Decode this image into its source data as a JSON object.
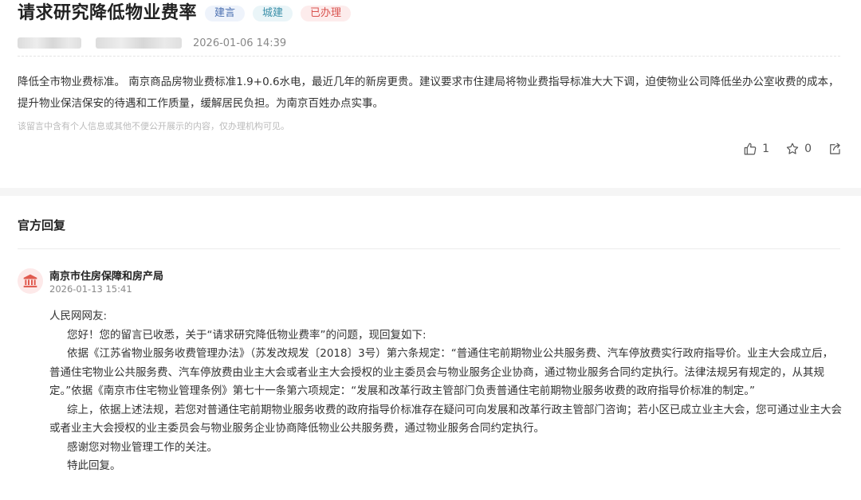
{
  "message": {
    "title": "请求研究降低物业费率",
    "tags": [
      {
        "label": "建言",
        "style": "blue"
      },
      {
        "label": "城建",
        "style": "cyan"
      },
      {
        "label": "已办理",
        "style": "red"
      }
    ],
    "datetime": "2026-01-06 14:39",
    "body": "降低全市物业费标准。 南京商品房物业费标准1.9+0.6水电，最近几年的新房更贵。建议要求市住建局将物业费指导标准大大下调，迫使物业公司降低坐办公室收费的成本，提升物业保洁保安的待遇和工作质量，缓解居民负担。为南京百姓办点实事。",
    "privacy_note": "该留言中含有个人信息或其他不便公开展示的内容，仅办理机构可见。",
    "likes": "1",
    "favorites": "0"
  },
  "reply_section": {
    "title": "官方回复",
    "department": "南京市住房保障和房产局",
    "datetime": "2026-01-13 15:41",
    "salutation": "人民网网友:",
    "paragraphs": [
      "您好！您的留言已收悉，关于“请求研究降低物业费率”的问题，现回复如下:",
      "依据《江苏省物业服务收费管理办法》（苏发改规发〔2018〕3号）第六条规定：“普通住宅前期物业公共服务费、汽车停放费实行政府指导价。业主大会成立后，普通住宅物业公共服务费、汽车停放费由业主大会或者业主大会授权的业主委员会与物业服务企业协商，通过物业服务合同约定执行。法律法规另有规定的，从其规定。”依据《南京市住宅物业管理条例》第七十一条第六项规定：“发展和改革行政主管部门负责普通住宅前期物业服务收费的政府指导价标准的制定。”",
      "综上，依据上述法规，若您对普通住宅前期物业服务收费的政府指导价标准存在疑问可向发展和改革行政主管部门咨询；若小区已成立业主大会，您可通过业主大会或者业主大会授权的业主委员会与物业服务企业协商降低物业公共服务费，通过物业服务合同约定执行。",
      "感谢您对物业管理工作的关注。",
      "特此回复。"
    ]
  },
  "icons": {
    "like": "thumbs-up-icon",
    "favorite": "star-icon",
    "share": "share-icon",
    "department": "government-building-icon"
  },
  "colors": {
    "tag_blue": "#4a6fb0",
    "tag_cyan": "#3a8fa8",
    "tag_red": "#d9534f",
    "dept_icon": "#e05a4f"
  }
}
